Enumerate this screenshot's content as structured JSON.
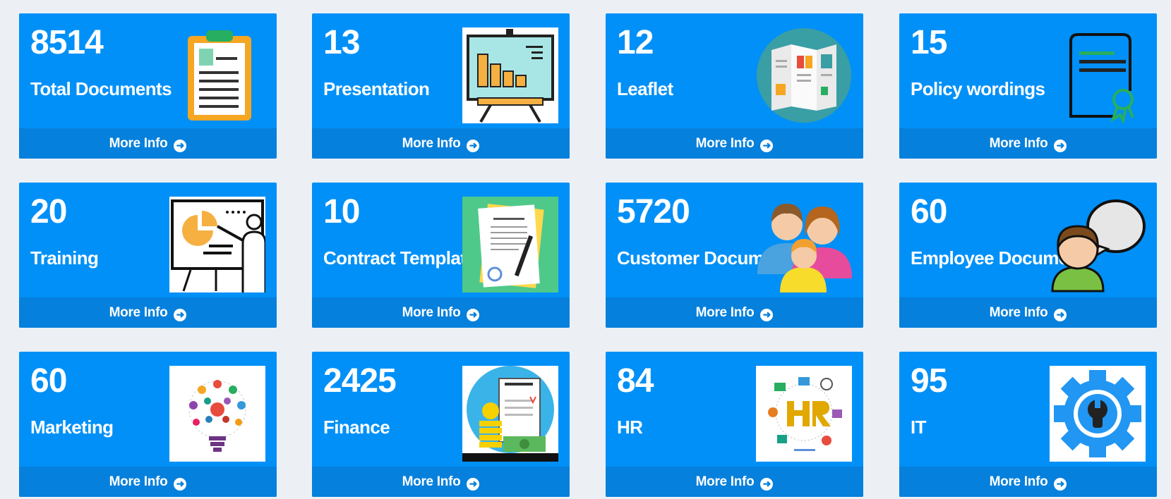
{
  "tiles": [
    {
      "count": "8514",
      "label": "Total Documents",
      "icon": "clipboard-icon",
      "more": "More Info"
    },
    {
      "count": "13",
      "label": "Presentation",
      "icon": "presentation-board-icon",
      "more": "More Info"
    },
    {
      "count": "12",
      "label": "Leaflet",
      "icon": "leaflet-icon",
      "more": "More Info"
    },
    {
      "count": "15",
      "label": "Policy wordings",
      "icon": "certificate-icon",
      "more": "More Info"
    },
    {
      "count": "20",
      "label": "Training",
      "icon": "training-icon",
      "more": "More Info"
    },
    {
      "count": "10",
      "label": "Contract Templat",
      "icon": "contract-icon",
      "more": "More Info"
    },
    {
      "count": "5720",
      "label": "Customer Docum",
      "icon": "customers-icon",
      "more": "More Info"
    },
    {
      "count": "60",
      "label": "Employee Docume",
      "icon": "employee-chat-icon",
      "more": "More Info"
    },
    {
      "count": "60",
      "label": "Marketing",
      "icon": "lightbulb-icon",
      "more": "More Info"
    },
    {
      "count": "2425",
      "label": "Finance",
      "icon": "finance-plan-icon",
      "more": "More Info"
    },
    {
      "count": "84",
      "label": "HR",
      "icon": "hr-icon",
      "more": "More Info"
    },
    {
      "count": "95",
      "label": "IT",
      "icon": "gear-wrench-icon",
      "more": "More Info"
    }
  ],
  "colors": {
    "tile": "#0090f7",
    "footer": "#0580dc",
    "background": "#ecf0f5"
  }
}
